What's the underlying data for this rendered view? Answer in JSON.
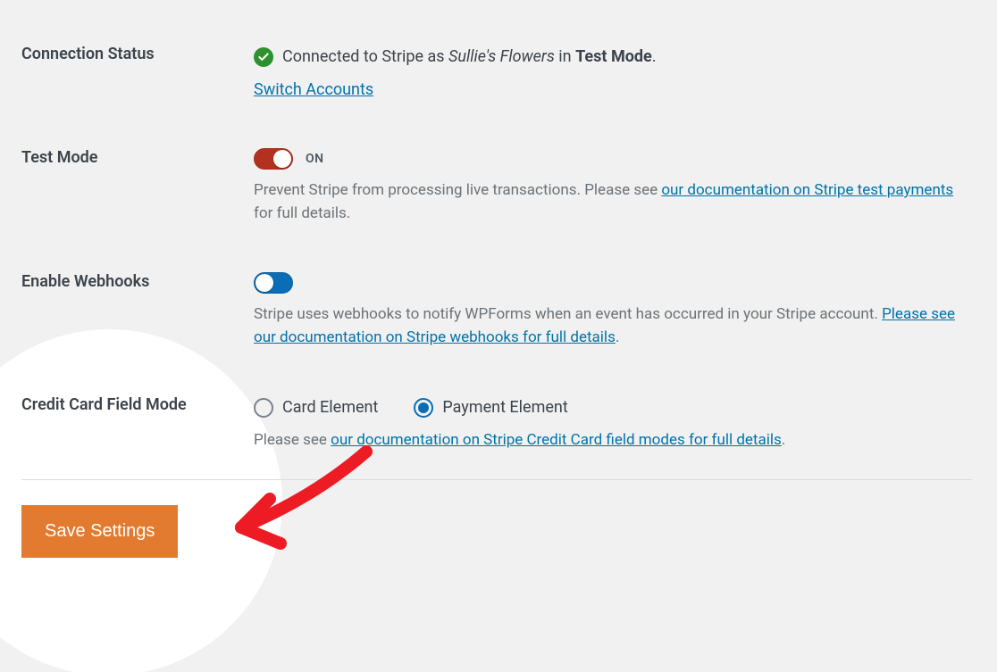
{
  "connectionStatus": {
    "label": "Connection Status",
    "prefix": "Connected to Stripe as ",
    "account": "Sullie's Flowers",
    "middle": " in ",
    "mode": "Test Mode",
    "suffix": ".",
    "switchAccounts": "Switch Accounts"
  },
  "testMode": {
    "label": "Test Mode",
    "state": "ON",
    "help_pre": "Prevent Stripe from processing live transactions. Please see ",
    "link": "our documentation on Stripe test payments",
    "help_post": " for full details."
  },
  "webhooks": {
    "label": "Enable Webhooks",
    "help_pre": "Stripe uses webhooks to notify WPForms when an event has occurred in your Stripe account. ",
    "link": "Please see our documentation on Stripe webhooks for full details",
    "help_post": "."
  },
  "cardMode": {
    "label": "Credit Card Field Mode",
    "options": {
      "card": "Card Element",
      "payment": "Payment Element"
    },
    "help_pre": "Please see ",
    "link": "our documentation on Stripe Credit Card field modes for full details",
    "help_post": "."
  },
  "saveLabel": "Save Settings"
}
